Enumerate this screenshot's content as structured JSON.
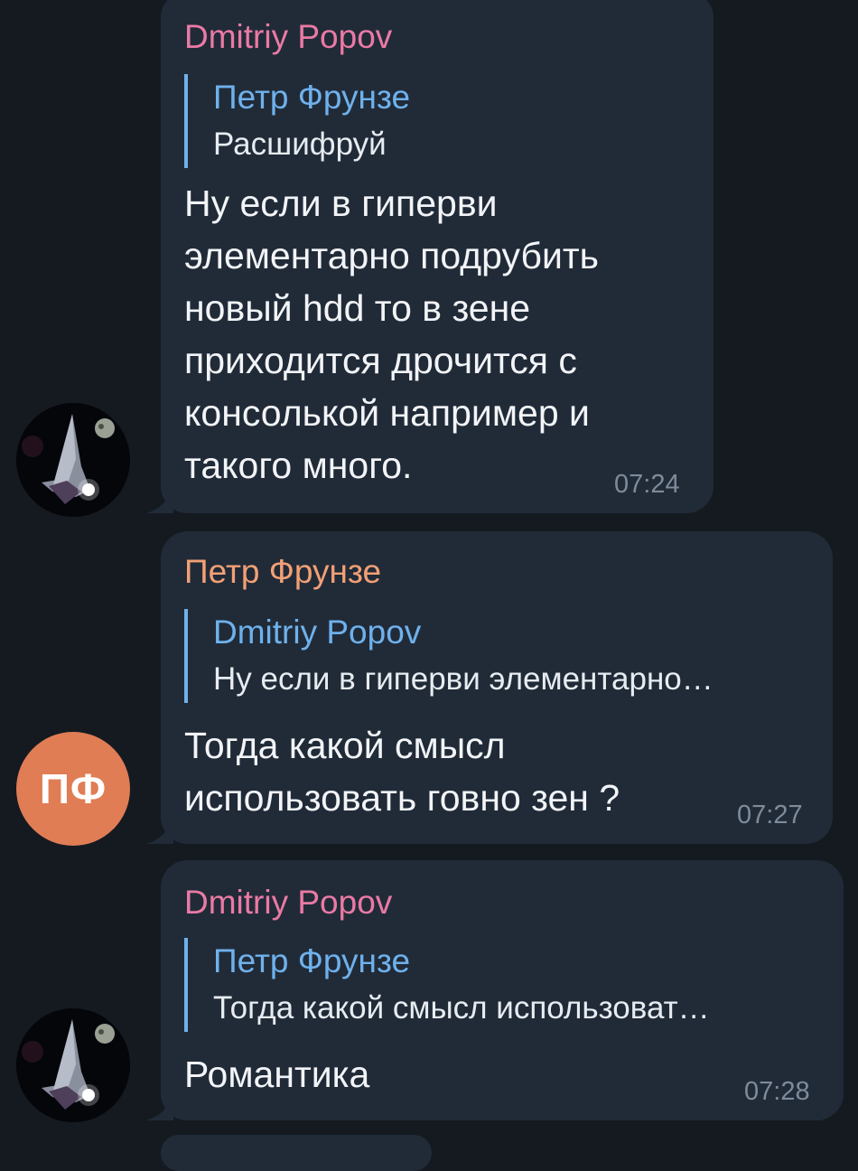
{
  "colors": {
    "background": "#151a21",
    "bubble": "#212b38",
    "sender_pink": "#ea7aa4",
    "sender_orange": "#f2a075",
    "reply_blue": "#6fb1ec",
    "avatar_orange": "#e07d55",
    "time_gray": "#7d8b9b"
  },
  "messages": [
    {
      "sender": "Dmitriy Popov",
      "reply_to_name": "Петр Фрунзе",
      "reply_to_text": "Расшифруй",
      "lines": [
        "Ну если в гиперви",
        "элементарно подрубить",
        "новый hdd то в зене",
        "приходится дрочится с",
        "консолькой например и",
        "такого много."
      ],
      "time": "07:24"
    },
    {
      "sender": "Петр Фрунзе",
      "avatar_initials": "ПФ",
      "reply_to_name": "Dmitriy Popov",
      "reply_to_text": "Ну если в гиперви элементарно…",
      "lines": [
        "Тогда какой смысл",
        "использовать говно зен ?"
      ],
      "time": "07:27"
    },
    {
      "sender": "Dmitriy Popov",
      "reply_to_name": "Петр Фрунзе",
      "reply_to_text": "Тогда какой смысл использоват…",
      "lines": [
        "Романтика"
      ],
      "time": "07:28"
    }
  ]
}
